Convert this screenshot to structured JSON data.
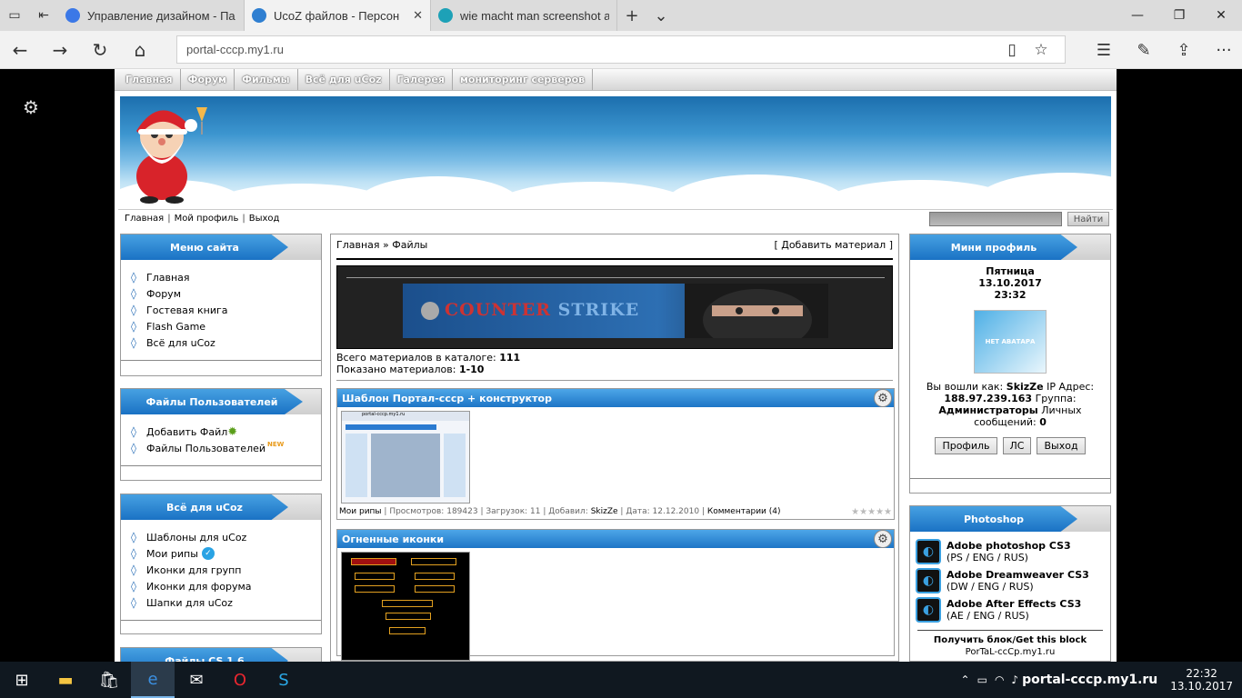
{
  "browser": {
    "tabs": [
      {
        "title": "Управление дизайном - Па",
        "active": false,
        "color": "#3b78e7"
      },
      {
        "title": "UcoZ файлов - Персон",
        "active": true,
        "color": "#2f7fd1"
      },
      {
        "title": "wie macht man screenshot a",
        "active": false,
        "color": "#1da1b7"
      }
    ],
    "url": "portal-cccp.my1.ru",
    "icons": {
      "back": "back-arrow-icon",
      "forward": "forward-arrow-icon",
      "refresh": "refresh-icon",
      "home": "home-icon",
      "reading": "reading-view-icon",
      "favorite": "star-icon",
      "hub": "hub-icon",
      "note": "pen-icon",
      "share": "share-icon",
      "more": "more-icon"
    }
  },
  "site": {
    "top_menu": [
      "Главная",
      "Форум",
      "Фильмы",
      "Всё для uCoz",
      "Галерея",
      "мониторинг серверов"
    ],
    "userbar": {
      "home": "Главная",
      "profile": "Мой профиль",
      "logout": "Выход",
      "sep": "|",
      "search_btn": "Найти"
    },
    "left": {
      "site_menu": {
        "title": "Меню сайта",
        "items": [
          "Главная",
          "Форум",
          "Гостевая книга",
          "Flash Game",
          "Всё для uCoz"
        ]
      },
      "user_files": {
        "title": "Файлы Пользователей",
        "items": [
          "Добавить Файл",
          "Файлы Пользователей"
        ],
        "new_badge": "NEW"
      },
      "ucoz": {
        "title": "Всё для uCoz",
        "items": [
          "Шаблоны для uCoz",
          "Мои рипы",
          "Иконки для групп",
          "Иконки для форума",
          "Шапки для uCoz"
        ]
      },
      "cs": {
        "title": "Файлы CS 1.6"
      }
    },
    "center": {
      "breadcrumb_home": "Главная",
      "breadcrumb_sep": "»",
      "breadcrumb_current": "Файлы",
      "add_material": "[ Добавить материал ]",
      "banner_logo_1": "COUNTER",
      "banner_logo_2": "STRIKE",
      "total_label": "Всего материалов в каталоге:",
      "total_value": "111",
      "shown_label": "Показано материалов:",
      "shown_value": "1-10",
      "posts": [
        {
          "title": "Шаблон Портал-ссср + конструктор",
          "category": "Мои рипы",
          "views_label": "Просмотров:",
          "views": "189423",
          "downloads_label": "Загрузок:",
          "downloads": "11",
          "added_label": "Добавил:",
          "author": "SkizZe",
          "date_label": "Дата:",
          "date": "12.12.2010",
          "comments": "Комментарии (4)",
          "thumb_text": "portal-cccp.my1.ru"
        },
        {
          "title": "Огненные иконки"
        }
      ]
    },
    "right": {
      "mini_profile": {
        "title": "Мини профиль",
        "day": "Пятница",
        "date": "13.10.2017",
        "time": "23:32",
        "avatar_text": "НЕТ АВАТАРА",
        "logged_as": "Вы вошли как:",
        "username": "SkizZe",
        "ip_label": "IP Адрес:",
        "ip": "188.97.239.163",
        "group_label": "Группа:",
        "group": "Администраторы",
        "messages_label": "Личных сообщений:",
        "messages": "0",
        "buttons": [
          "Профиль",
          "ЛС",
          "Выход"
        ]
      },
      "photoshop": {
        "title": "Photoshop",
        "items": [
          {
            "name": "Adobe photoshop CS3",
            "sub": "(PS / ENG / RUS)"
          },
          {
            "name": "Adobe Dreamweaver CS3",
            "sub": "(DW / ENG / RUS)"
          },
          {
            "name": "Adobe After Effects CS3",
            "sub": "(AE / ENG / RUS)"
          }
        ],
        "get_block": "Получить блок/Get this block",
        "get_block_site": "PorTaL-ccCp.my1.ru"
      }
    }
  },
  "taskbar": {
    "site": "portal-cccp.my1.ru",
    "time": "22:32",
    "date": "13.10.2017"
  }
}
